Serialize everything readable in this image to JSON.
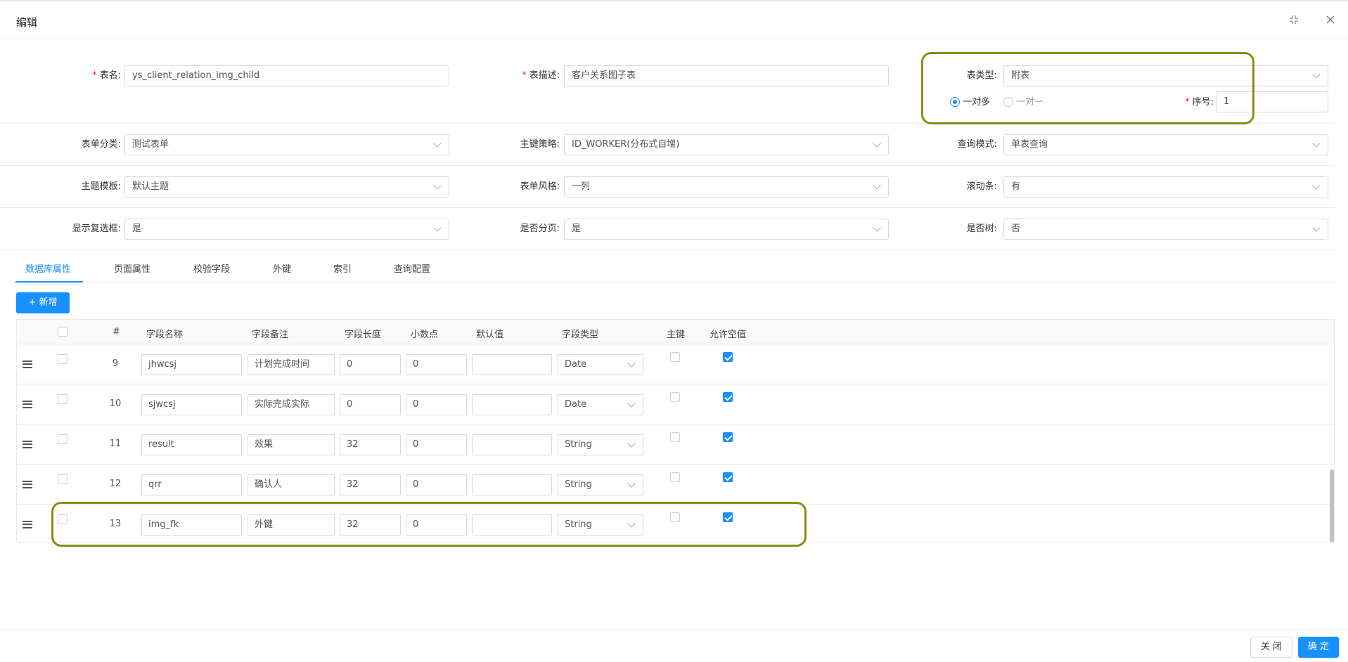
{
  "modal": {
    "title": "编辑"
  },
  "form": {
    "table_name": {
      "label": "表名:",
      "value": "ys_client_relation_img_child"
    },
    "table_desc": {
      "label": "表描述:",
      "value": "客户关系图子表"
    },
    "table_type": {
      "label": "表类型:",
      "value": "附表"
    },
    "relation": {
      "option1": "一对多",
      "option2": "一对一",
      "selected": "一对多"
    },
    "order": {
      "label": "序号:",
      "value": "1"
    },
    "form_category": {
      "label": "表单分类:",
      "value": "测试表单"
    },
    "pk_strategy": {
      "label": "主键策略:",
      "value": "ID_WORKER(分布式自增)"
    },
    "query_mode": {
      "label": "查询模式:",
      "value": "单表查询"
    },
    "theme": {
      "label": "主题模板:",
      "value": "默认主题"
    },
    "form_style": {
      "label": "表单风格:",
      "value": "一列"
    },
    "scrollbar": {
      "label": "滚动条:",
      "value": "有"
    },
    "show_checkbox": {
      "label": "显示复选框:",
      "value": "是"
    },
    "paging": {
      "label": "是否分页:",
      "value": "是"
    },
    "is_tree": {
      "label": "是否树:",
      "value": "否"
    }
  },
  "tabs": [
    "数据库属性",
    "页面属性",
    "校验字段",
    "外键",
    "索引",
    "查询配置"
  ],
  "toolbar": {
    "add_label": "+ 新增"
  },
  "columns": [
    "#",
    "字段名称",
    "字段备注",
    "字段长度",
    "小数点",
    "默认值",
    "字段类型",
    "主键",
    "允许空值"
  ],
  "rows": [
    {
      "index": "9",
      "name": "jhwcsj",
      "remark": "计划完成时间",
      "length": "0",
      "decimal": "0",
      "default": "",
      "type": "Date",
      "pk": false,
      "nullable": true
    },
    {
      "index": "10",
      "name": "sjwcsj",
      "remark": "实际完成实际",
      "length": "0",
      "decimal": "0",
      "default": "",
      "type": "Date",
      "pk": false,
      "nullable": true
    },
    {
      "index": "11",
      "name": "result",
      "remark": "效果",
      "length": "32",
      "decimal": "0",
      "default": "",
      "type": "String",
      "pk": false,
      "nullable": true
    },
    {
      "index": "12",
      "name": "qrr",
      "remark": "确认人",
      "length": "32",
      "decimal": "0",
      "default": "",
      "type": "String",
      "pk": false,
      "nullable": true
    },
    {
      "index": "13",
      "name": "img_fk",
      "remark": "外键",
      "length": "32",
      "decimal": "0",
      "default": "",
      "type": "String",
      "pk": false,
      "nullable": true
    }
  ],
  "footer": {
    "close_label": "关 闭",
    "ok_label": "确 定"
  },
  "colors": {
    "primary": "#1890ff",
    "highlight": "#8b8b14",
    "required": "#f5222d"
  }
}
